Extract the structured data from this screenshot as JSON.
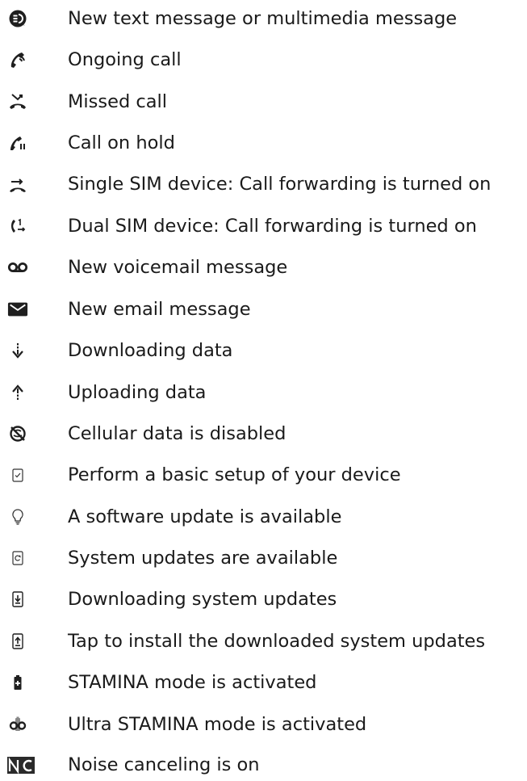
{
  "title": "",
  "items": [
    {
      "icon": "new-message-icon",
      "label": "New text message or multimedia message"
    },
    {
      "icon": "ongoing-call-icon",
      "label": "Ongoing call"
    },
    {
      "icon": "missed-call-icon",
      "label": "Missed call"
    },
    {
      "icon": "call-on-hold-icon",
      "label": "Call on hold"
    },
    {
      "icon": "call-forwarding-single-sim-icon",
      "label": "Single SIM device: Call forwarding is turned on"
    },
    {
      "icon": "call-forwarding-dual-sim-icon",
      "label": "Dual SIM device: Call forwarding is turned on"
    },
    {
      "icon": "voicemail-icon",
      "label": "New voicemail message"
    },
    {
      "icon": "email-icon",
      "label": "New email message"
    },
    {
      "icon": "downloading-data-icon",
      "label": "Downloading data"
    },
    {
      "icon": "uploading-data-icon",
      "label": "Uploading data"
    },
    {
      "icon": "cellular-data-disabled-icon",
      "label": "Cellular data is disabled"
    },
    {
      "icon": "basic-setup-icon",
      "label": "Perform a basic setup of your device"
    },
    {
      "icon": "software-update-bulb-icon",
      "label": "A software update is available"
    },
    {
      "icon": "system-updates-available-icon",
      "label": "System updates are available"
    },
    {
      "icon": "downloading-system-updates-icon",
      "label": "Downloading system updates"
    },
    {
      "icon": "install-system-updates-icon",
      "label": "Tap to install the downloaded system updates"
    },
    {
      "icon": "stamina-mode-icon",
      "label": "STAMINA mode is activated"
    },
    {
      "icon": "ultra-stamina-mode-icon",
      "label": "Ultra STAMINA mode is activated"
    },
    {
      "icon": "noise-canceling-icon",
      "label": "Noise canceling is on"
    }
  ],
  "colors": {
    "icon": "#1f1f1f",
    "text": "#1a1a1a",
    "background": "#ffffff"
  }
}
